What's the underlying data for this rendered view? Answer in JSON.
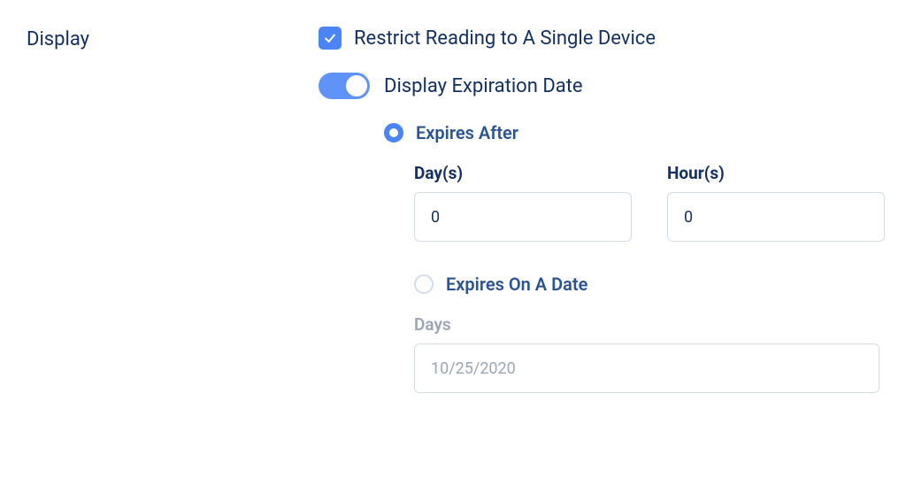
{
  "sidebar": {
    "section_label": "Display"
  },
  "settings": {
    "restrict_device": {
      "label": "Restrict Reading to A Single Device",
      "checked": true
    },
    "expiration": {
      "toggle_label": "Display Expiration Date",
      "enabled": true,
      "mode": "expires_after",
      "expires_after": {
        "radio_label": "Expires After",
        "days_label": "Day(s)",
        "days_value": "0",
        "hours_label": "Hour(s)",
        "hours_value": "0"
      },
      "expires_on_date": {
        "radio_label": "Expires On A Date",
        "date_label": "Days",
        "date_value": "10/25/2020"
      }
    }
  }
}
